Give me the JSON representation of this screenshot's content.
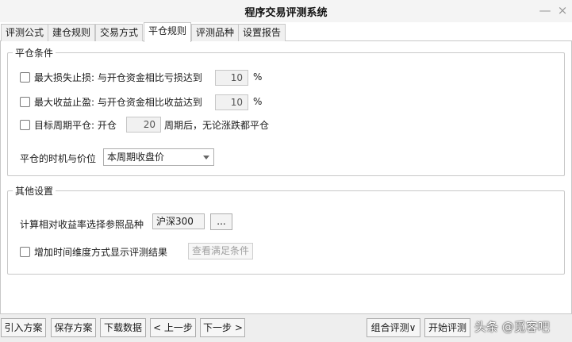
{
  "window": {
    "title": "程序交易评测系统",
    "minimize_glyph": "—",
    "close_glyph": "×"
  },
  "tabs": [
    {
      "label": "评测公式"
    },
    {
      "label": "建仓规则"
    },
    {
      "label": "交易方式"
    },
    {
      "label": "平仓规则",
      "active": true
    },
    {
      "label": "评测品种"
    },
    {
      "label": "设置报告"
    }
  ],
  "close_conditions": {
    "legend": "平仓条件",
    "stop_loss": {
      "label": "最大损失止损: 与开仓资金相比亏损达到",
      "value": "10",
      "unit": "%",
      "checked": false
    },
    "take_profit": {
      "label": "最大收益止盈: 与开仓资金相比收益达到",
      "value": "10",
      "unit": "%",
      "checked": false
    },
    "target_period": {
      "label_prefix": "目标周期平仓: 开仓",
      "value": "20",
      "label_suffix": "周期后，无论涨跌都平仓",
      "checked": false
    },
    "timing": {
      "label": "平仓的时机与价位",
      "selected": "本周期收盘价"
    }
  },
  "other_settings": {
    "legend": "其他设置",
    "reference": {
      "label": "计算相对收益率选择参照品种",
      "value": "沪深300",
      "browse_label": "..."
    },
    "time_dimension": {
      "label": "增加时间维度方式显示评测结果",
      "checked": false,
      "button_label": "查看满足条件"
    }
  },
  "bottom_bar": {
    "import_label": "引入方案",
    "save_label": "保存方案",
    "download_label": "下载数据",
    "prev_label": "< 上一步",
    "next_label": "下一步 >",
    "combo_label": "组合评测∨",
    "start_label": "开始评测"
  },
  "watermark": "头条 @觅客吧"
}
